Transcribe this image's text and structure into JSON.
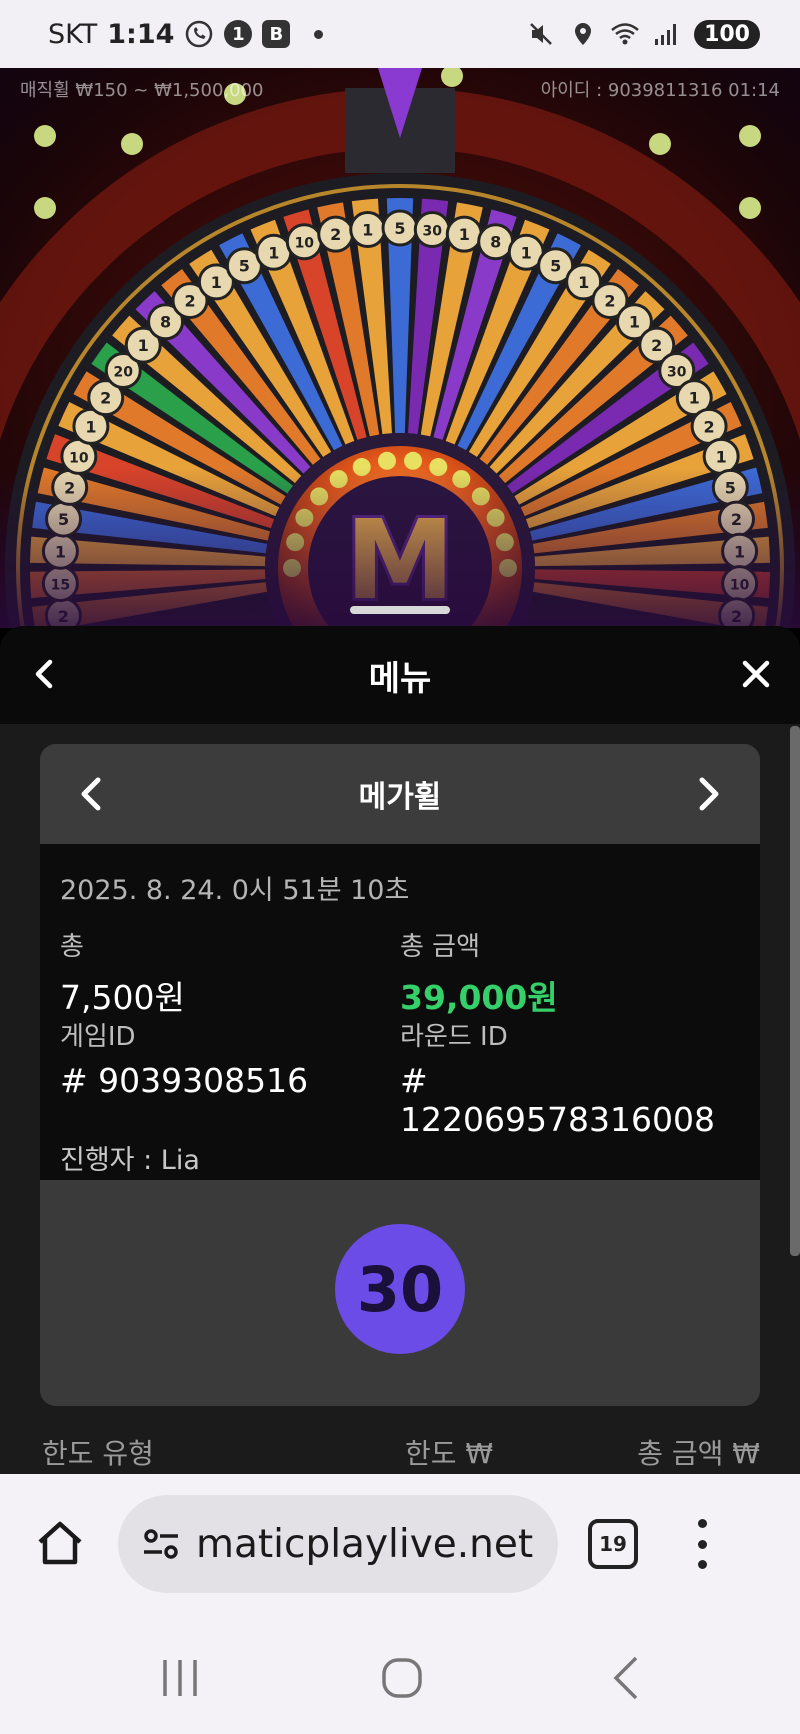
{
  "status_bar": {
    "carrier": "SKT",
    "time": "1:14",
    "badge_1": "1",
    "badge_b": "B",
    "battery": "100"
  },
  "game": {
    "bet_range": "매직휠 ₩150 ~ ₩1,500,000",
    "user_id": "아이디 : 9039811316   01:14",
    "wheel_segments": [
      "2",
      "15",
      "1",
      "5",
      "2",
      "10",
      "1",
      "2",
      "20",
      "1",
      "8",
      "2",
      "1",
      "5",
      "1",
      "10",
      "2",
      "1",
      "5",
      "30",
      "1",
      "8",
      "1",
      "5",
      "1",
      "2",
      "1",
      "2",
      "30",
      "1",
      "2",
      "1",
      "5",
      "2",
      "1",
      "10",
      "2"
    ],
    "center_logo": "M"
  },
  "panel": {
    "title": "메뉴",
    "card": {
      "game_name": "메가휠",
      "datetime": "2025. 8. 24. 0시 51분 10초",
      "total_label": "총",
      "total_value": "7,500원",
      "total_amount_label": "총 금액",
      "total_amount_value": "39,000원",
      "game_id_label": "게임ID",
      "game_id_value": "# 9039308516",
      "round_id_label": "라운드 ID",
      "round_id_value": "# 122069578316008",
      "host": "진행자 : Lia",
      "result": "30"
    },
    "table_head": {
      "col1": "한도 유형",
      "col2": "한도 ₩",
      "col3": "총 금액 ₩"
    }
  },
  "browser": {
    "url": "maticplaylive.net",
    "tab_count": "19"
  },
  "colors": {
    "accent_green": "#35d06a",
    "result_purple": "#6b4ce6"
  }
}
